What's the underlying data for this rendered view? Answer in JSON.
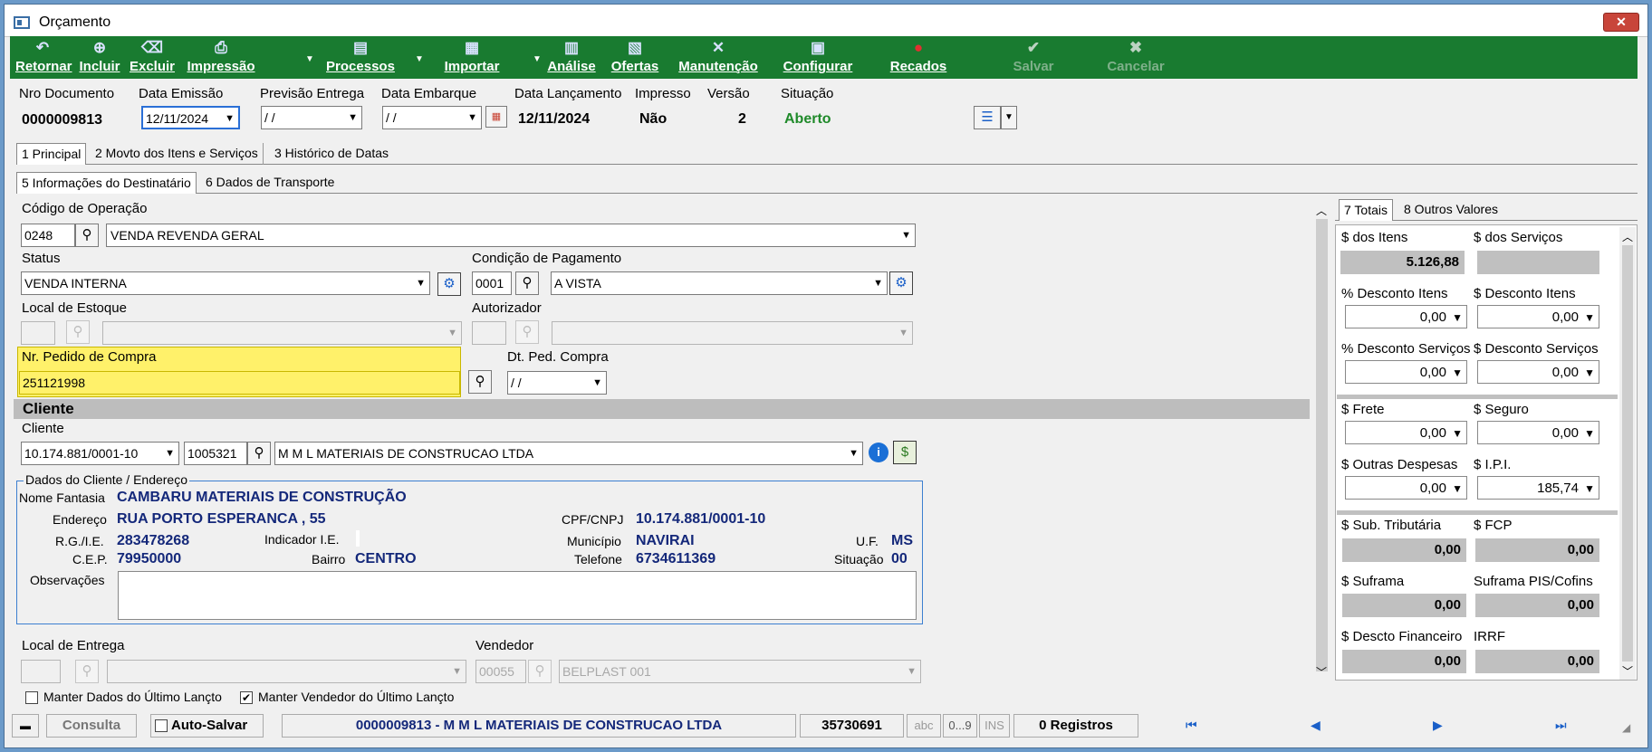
{
  "window": {
    "title": "Orçamento",
    "close": "✕"
  },
  "toolbar": {
    "retornar": "Retornar",
    "incluir": "Incluir",
    "excluir": "Excluir",
    "impressao": "Impressão",
    "processos": "Processos",
    "importar": "Importar",
    "analise": "Análise",
    "ofertas": "Ofertas",
    "manutencao": "Manutenção",
    "configurar": "Configurar",
    "recados": "Recados",
    "salvar": "Salvar",
    "cancelar": "Cancelar"
  },
  "header": {
    "nro_label": "Nro Documento",
    "nro_value": "0000009813",
    "emissao_label": "Data Emissão",
    "emissao_value": "12/11/2024",
    "previsao_label": "Previsão Entrega",
    "previsao_value": "/ /",
    "embarque_label": "Data Embarque",
    "embarque_value": "/ /",
    "lancamento_label": "Data Lançamento",
    "lancamento_value": "12/11/2024",
    "impresso_label": "Impresso",
    "impresso_value": "Não",
    "versao_label": "Versão",
    "versao_value": "2",
    "situacao_label": "Situação",
    "situacao_value": "Aberto",
    "situacao_color": "#1f8a2a"
  },
  "tabs1": [
    "1 Principal",
    "2 Movto dos Itens e Serviços",
    "3 Histórico de Datas"
  ],
  "tabs2": [
    "5 Informações do Destinatário",
    "6 Dados de Transporte"
  ],
  "form": {
    "cod_op_label": "Código de Operação",
    "cod_op_code": "0248",
    "cod_op_desc": "VENDA REVENDA GERAL",
    "status_label": "Status",
    "status_value": "VENDA INTERNA",
    "cond_label": "Condição de Pagamento",
    "cond_code": "0001",
    "cond_desc": "A VISTA",
    "local_label": "Local de Estoque",
    "autorizador_label": "Autorizador",
    "pedido_label": "Nr. Pedido de Compra",
    "pedido_value": "251121998",
    "dtped_label": "Dt. Ped. Compra",
    "dtped_value": "/ /",
    "cliente_section": "Cliente",
    "cliente_label": "Cliente",
    "cliente_cnpj": "10.174.881/0001-10",
    "cliente_code": "1005321",
    "cliente_name": "M M L MATERIAIS DE CONSTRUCAO LTDA",
    "highlight": "#fff16a"
  },
  "dados": {
    "group_label": "Dados do Cliente / Endereço",
    "fantasia_label": "Nome Fantasia",
    "fantasia": "CAMBARU MATERIAIS DE CONSTRUÇÃO",
    "endereco_label": "Endereço",
    "endereco": "RUA PORTO ESPERANCA , 55",
    "cpf_label": "CPF/CNPJ",
    "cpf": "10.174.881/0001-10",
    "rg_label": "R.G./I.E.",
    "rg": "283478268",
    "indicador_label": "Indicador I.E.",
    "municipio_label": "Município",
    "municipio": "NAVIRAI",
    "uf_label": "U.F.",
    "uf": "MS",
    "cep_label": "C.E.P.",
    "cep": "79950000",
    "bairro_label": "Bairro",
    "bairro": "CENTRO",
    "telefone_label": "Telefone",
    "telefone": "6734611369",
    "situacao_label": "Situação",
    "situacao": "00",
    "obs_label": "Observações"
  },
  "entrega": {
    "local_label": "Local de Entrega",
    "vendedor_label": "Vendedor",
    "vendedor_code": "00055",
    "vendedor_name": "BELPLAST 001"
  },
  "checks": {
    "manter_dados": "Manter Dados do Último Lançto",
    "manter_vendedor": "Manter Vendedor do Último Lançto"
  },
  "totals": {
    "tab1": "7 Totais",
    "tab2": "8 Outros Valores",
    "itens_label": "$ dos Itens",
    "itens": "5.126,88",
    "servicos_label": "$ dos Serviços",
    "pdi_label": "% Desconto Itens",
    "pdi": "0,00",
    "sdi_label": "$ Desconto Itens",
    "sdi": "0,00",
    "pds_label": "% Desconto Serviços",
    "pds": "0,00",
    "sds_label": "$ Desconto Serviços",
    "sds": "0,00",
    "frete_label": "$ Frete",
    "frete": "0,00",
    "seguro_label": "$ Seguro",
    "seguro": "0,00",
    "outras_label": "$ Outras Despesas",
    "outras": "0,00",
    "ipi_label": "$ I.P.I.",
    "ipi": "185,74",
    "st_label": "$ Sub. Tributária",
    "st": "0,00",
    "fcp_label": "$ FCP",
    "fcp": "0,00",
    "suframa_label": "$ Suframa",
    "suframa": "0,00",
    "supis_label": "Suframa PIS/Cofins",
    "supis": "0,00",
    "descfin_label": "$ Descto Financeiro",
    "descfin": "0,00",
    "irrf_label": "IRRF",
    "irrf": "0,00"
  },
  "statusbar": {
    "consulta": "Consulta",
    "autosalvar": "Auto-Salvar",
    "doc": "0000009813 - M M L MATERIAIS DE CONSTRUCAO LTDA",
    "num": "35730691",
    "abc": "abc",
    "range": "0...9",
    "ins": "INS",
    "registros": "0 Registros"
  }
}
